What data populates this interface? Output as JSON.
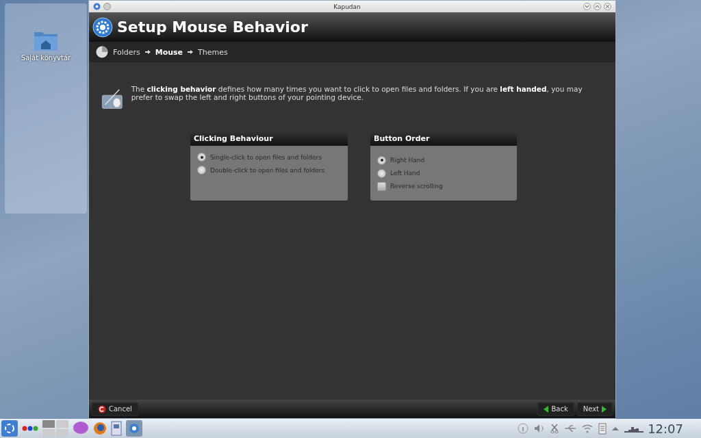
{
  "desktop": {
    "folder_label": "Saját könyvtár"
  },
  "window": {
    "title": "Kapudan"
  },
  "header": {
    "title": "Setup Mouse Behavior"
  },
  "breadcrumb": [
    {
      "label": "Folders",
      "selected": false
    },
    {
      "label": "Mouse",
      "selected": true
    },
    {
      "label": "Themes",
      "selected": false
    }
  ],
  "intro": "The **clicking behavior** defines how many times you want to click to open files and folders. If you are **left handed**, you may prefer to swap the left and right buttons of your pointing device.",
  "groups": [
    {
      "title": "Clicking Behaviour",
      "options": [
        {
          "kind": "radio",
          "label": "Single-click to open files and folders",
          "selected": true
        },
        {
          "kind": "radio",
          "label": "Double-click to open files and folders",
          "selected": false
        }
      ]
    },
    {
      "title": "Button Order",
      "options": [
        {
          "kind": "radio",
          "label": "Right Hand",
          "selected": true
        },
        {
          "kind": "radio",
          "label": "Left Hand",
          "selected": false
        },
        {
          "kind": "checkbox",
          "label": "Reverse scrolling",
          "checked": false
        }
      ]
    }
  ],
  "footer": {
    "cancel": "Cancel",
    "back": "Back",
    "next": "Next"
  },
  "taskbar": {
    "clock": "12:07"
  }
}
